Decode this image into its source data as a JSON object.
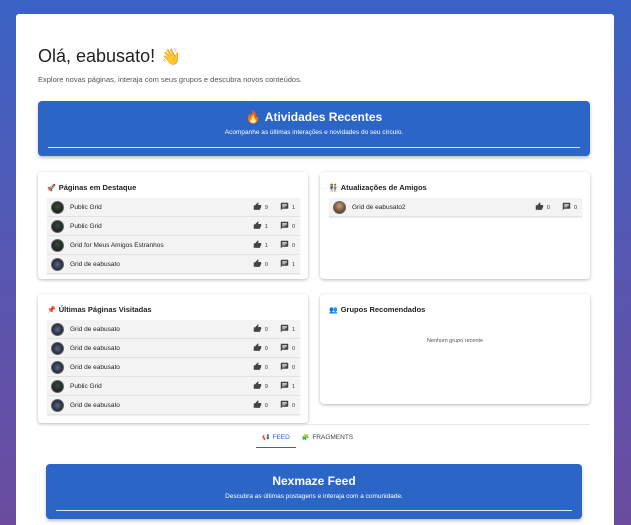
{
  "header": {
    "greeting": "Olá, eabusato!",
    "greeting_emoji": "👋",
    "subtitle": "Explore novas páginas, interaja com seus grupos e descubra novos conteúdos."
  },
  "activity_banner": {
    "icon": "🔥",
    "title": "Atividades Recentes",
    "subtitle": "Acompanhe as últimas interações e novidades do seu círculo."
  },
  "featured_pages": {
    "icon": "🚀",
    "title": "Páginas em Destaque",
    "items": [
      {
        "name": "Public Grid",
        "likes": "9",
        "comments": "1",
        "avatar": "grid"
      },
      {
        "name": "Public Grid",
        "likes": "1",
        "comments": "0",
        "avatar": "grid"
      },
      {
        "name": "Grid for Meus Amigos Estranhos",
        "likes": "1",
        "comments": "0",
        "avatar": "grid"
      },
      {
        "name": "Grid de eabusato",
        "likes": "0",
        "comments": "1",
        "avatar": "dark"
      }
    ]
  },
  "friend_updates": {
    "icon": "👫",
    "title": "Atualizações de Amigos",
    "items": [
      {
        "name": "Grid de eabusato2",
        "likes": "0",
        "comments": "0",
        "avatar": "person"
      }
    ]
  },
  "recent_pages": {
    "icon": "📌",
    "title": "Últimas Páginas Visitadas",
    "items": [
      {
        "name": "Grid de eabusato",
        "likes": "0",
        "comments": "1",
        "avatar": "dark"
      },
      {
        "name": "Grid de eabusato",
        "likes": "0",
        "comments": "0",
        "avatar": "dark"
      },
      {
        "name": "Grid de eabusato",
        "likes": "0",
        "comments": "0",
        "avatar": "dark"
      },
      {
        "name": "Public Grid",
        "likes": "9",
        "comments": "1",
        "avatar": "grid"
      },
      {
        "name": "Grid de eabusato",
        "likes": "0",
        "comments": "0",
        "avatar": "dark"
      }
    ]
  },
  "recommended_groups": {
    "icon": "👥",
    "title": "Grupos Recomendados",
    "empty_text": "Nenhum grupo recente"
  },
  "tabs": [
    {
      "label": "FEED",
      "icon": "📢",
      "active": true
    },
    {
      "label": "FRAGMENTS",
      "icon": "🧩",
      "active": false
    }
  ],
  "feed_banner": {
    "title": "Nexmaze Feed",
    "subtitle": "Descubra as últimas postagens e interaja com a comunidade."
  },
  "colors": {
    "accent": "#2b66c6",
    "background_top": "#3a63c4",
    "background_bottom": "#6b4c9e"
  }
}
